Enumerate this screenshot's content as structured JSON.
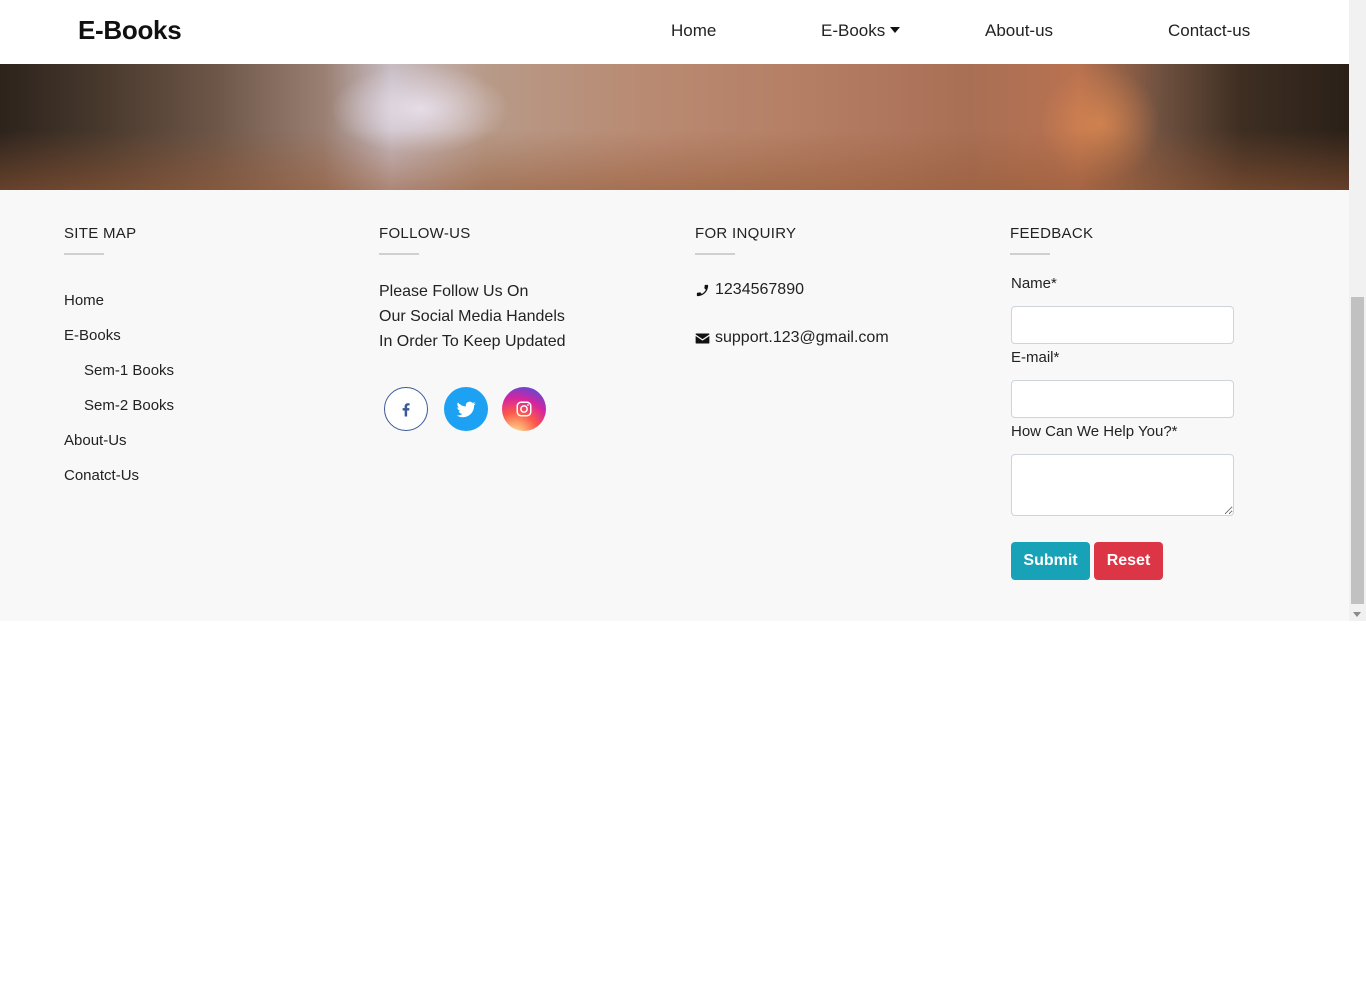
{
  "navbar": {
    "brand": "E-Books",
    "links": [
      "Home",
      "E-Books",
      "About-us",
      "Contact-us"
    ]
  },
  "footer": {
    "sitemap": {
      "title": "SITE MAP",
      "items": [
        "Home",
        "E-Books",
        "Sem-1 Books",
        "Sem-2 Books",
        "About-Us",
        "Conatct-Us"
      ]
    },
    "follow": {
      "title": "FOLLOW-US",
      "lines": [
        "Please Follow Us On",
        "Our Social Media Handels",
        "In Order To Keep Updated"
      ],
      "icons": [
        "facebook-icon",
        "twitter-icon",
        "instagram-icon"
      ]
    },
    "inquiry": {
      "title": "FOR INQUIRY",
      "phone": "1234567890",
      "email": "support.123@gmail.com"
    },
    "feedback": {
      "title": "FEEDBACK",
      "name_label": "Name*",
      "email_label": "E-mail*",
      "help_label": "How Can We Help You?*",
      "name_value": "",
      "email_value": "",
      "help_value": "",
      "submit_label": "Submit",
      "reset_label": "Reset"
    }
  },
  "colors": {
    "submit": "#17a2b8",
    "reset": "#dc3545",
    "footer_bg": "#f8f8f8",
    "twitter": "#1da1f2",
    "facebook": "#3b5998"
  }
}
